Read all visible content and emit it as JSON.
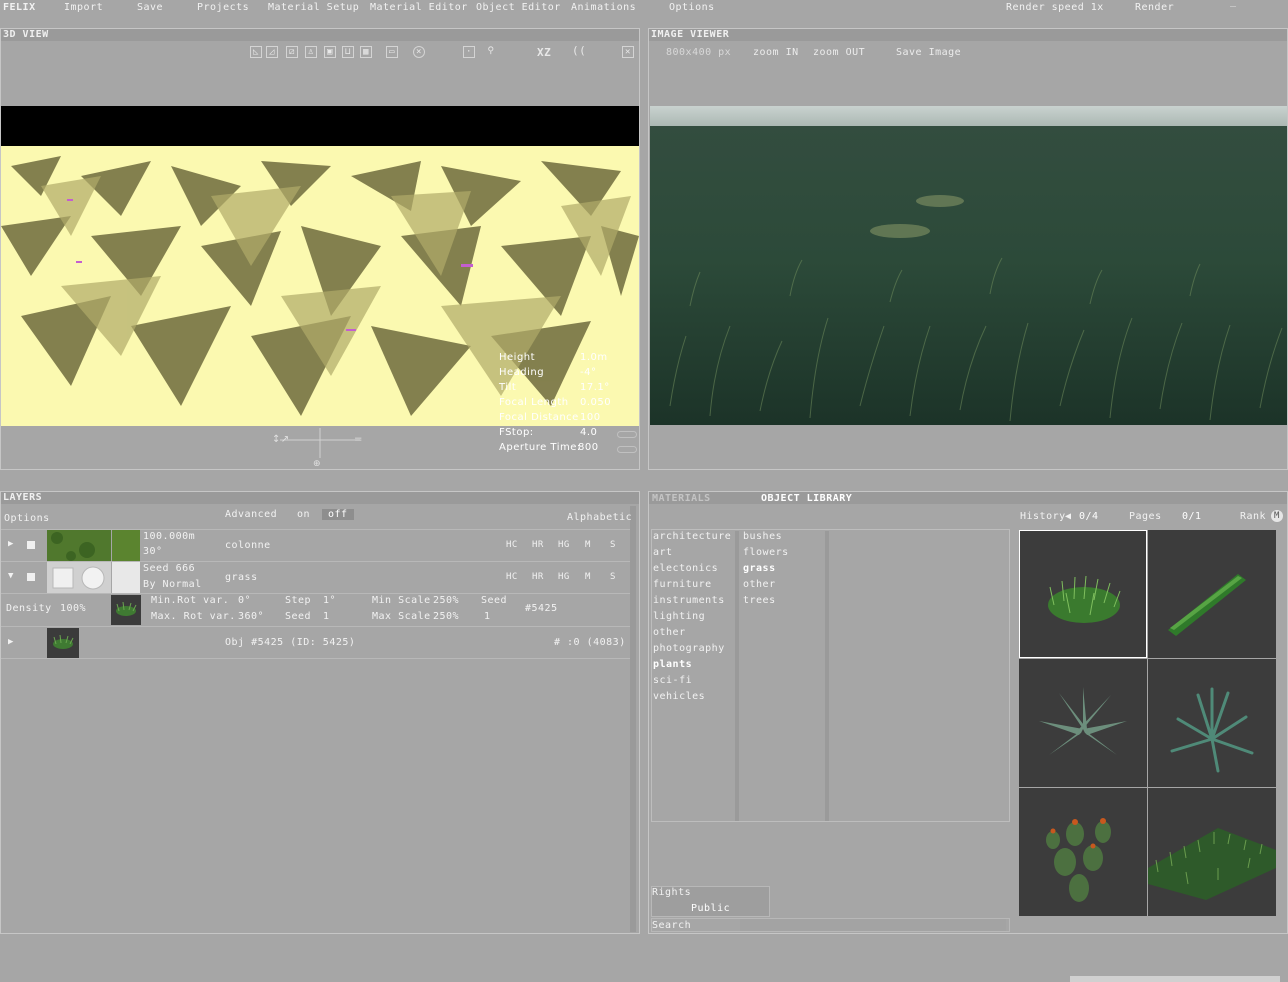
{
  "menu": {
    "app_name": "FELIX",
    "items": [
      "Import",
      "Save",
      "Projects",
      "Material Setup",
      "Material Editor",
      "Object Editor",
      "Animations",
      "Options"
    ],
    "render_speed": "Render speed 1x",
    "render": "Render",
    "window_controls": [
      "_",
      "‾"
    ]
  },
  "view3d": {
    "title": "3D VIEW",
    "toolbar_icons": [
      "triangle-icon",
      "wedge-icon",
      "slash-box-icon",
      "chair-icon",
      "cube-icon",
      "bucket-icon",
      "grid-icon",
      "window-icon",
      "target-icon",
      "add-box-icon",
      "light-icon",
      "xz-axis-icon",
      "camera-lens-icon",
      "close-icon"
    ],
    "xz_label": "XZ",
    "camera": {
      "labels": [
        "Height",
        "Heading",
        "Tilt",
        "Focal Length",
        "Focal Distance",
        "FStop:",
        "Aperture Time:"
      ],
      "values": [
        "1.0m",
        "-4°",
        "17.1°",
        "0.050",
        "100",
        "4.0",
        "800"
      ]
    }
  },
  "image_viewer": {
    "title": "IMAGE VIEWER",
    "size": "800x400 px",
    "zoom_in": "zoom IN",
    "zoom_out": "zoom OUT",
    "save_image": "Save Image"
  },
  "layers": {
    "title": "LAYERS",
    "options": "Options",
    "advanced": "Advanced",
    "on": "on",
    "off": "off",
    "alphabetic": "Alphabetic",
    "rows": [
      {
        "line1": "100.000m",
        "line2": "30°",
        "name": "colonne",
        "flags": [
          "HC",
          "HR",
          "HG",
          "M",
          "S"
        ]
      },
      {
        "line1": "Seed 666",
        "line2": "By Normal",
        "name": "grass",
        "flags": [
          "HC",
          "HR",
          "HG",
          "M",
          "S"
        ]
      }
    ],
    "density_label": "Density",
    "density_value": "100%",
    "min_rot_label": "Min.Rot var.",
    "min_rot_value": "0°",
    "max_rot_label": "Max. Rot var.",
    "max_rot_value": "360°",
    "step_label": "Step",
    "step_value": "1°",
    "seed_label": "Seed",
    "seed_value": "1",
    "min_scale_label": "Min Scale",
    "min_scale_value": "250%",
    "max_scale_label": "Max Scale",
    "max_scale_value": "250%",
    "seed2_label": "Seed",
    "seed2_value": "1",
    "obj_ref": "#5425",
    "object_row": "Obj #5425 (ID: 5425)",
    "object_count": "# :0 (4083)"
  },
  "library": {
    "materials_tab": "MATERIALS",
    "object_library_tab": "OBJECT LIBRARY",
    "history": "History",
    "history_value": "0/4",
    "pages": "Pages",
    "pages_value": "0/1",
    "rank": "Rank",
    "categories": [
      "architecture",
      "art",
      "electonics",
      "furniture",
      "instruments",
      "lighting",
      "other",
      "photography",
      "plants",
      "sci-fi",
      "vehicles"
    ],
    "subcategories": [
      "bushes",
      "flowers",
      "grass",
      "other",
      "trees"
    ],
    "rights": "Rights",
    "public": "Public",
    "search": "Search",
    "colors": {
      "grass_dark": "#2e5a2a",
      "grass_light": "#5f9a47",
      "tile_bg": "#3b3b3b"
    }
  }
}
